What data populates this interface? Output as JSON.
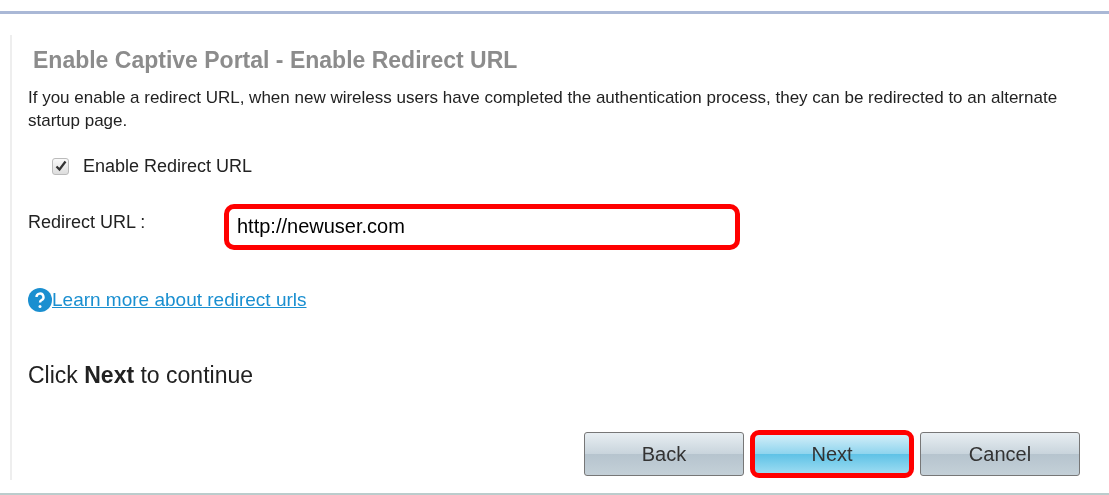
{
  "title": "Enable Captive Portal - Enable Redirect URL",
  "description": "If you enable a redirect URL, when new wireless users have completed the authentication process, they can be redirected to an alternate startup page.",
  "checkbox": {
    "label": "Enable Redirect URL",
    "checked": true
  },
  "redirect_url": {
    "label": "Redirect URL :",
    "value": "http://newuser.com",
    "highlighted": true
  },
  "help_link": {
    "label": "Learn more about redirect urls"
  },
  "instruction": "Click **Next** to continue",
  "buttons": [
    {
      "label": "Back",
      "primary": false,
      "highlighted": false
    },
    {
      "label": "Next",
      "primary": true,
      "highlighted": true
    },
    {
      "label": "Cancel",
      "primary": false,
      "highlighted": false
    }
  ]
}
